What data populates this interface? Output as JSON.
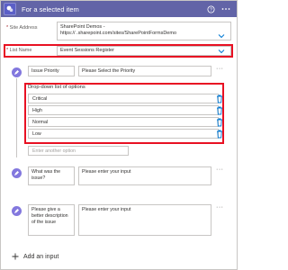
{
  "header": {
    "title": "For a selected item",
    "help_icon": "question-circle-icon",
    "more_icon": "more-dots-icon"
  },
  "site_address": {
    "label": "Site Address",
    "line1": "SharePoint Demos -",
    "line2": "https://                    .sharepoint.com/sites/SharePointFormsDemo"
  },
  "list_name": {
    "label": "List Name",
    "value": "Event Sessions Register"
  },
  "inputs": [
    {
      "title": "Issue Priority",
      "value": "Please Select the Priority",
      "dropdown_label": "Drop-down list of options",
      "options": [
        "Critical",
        "High",
        "Normal",
        "Low"
      ],
      "add_option_placeholder": "Enter another option"
    },
    {
      "title": "What was the issue?",
      "value": "Please enter your input"
    },
    {
      "title": "Please give a better description of the issue",
      "value": "Please enter your input"
    }
  ],
  "add_input_label": "Add an input",
  "colors": {
    "header": "#6264a7",
    "accent": "#8378de",
    "highlight": "#e81123",
    "delete": "#0078d4"
  }
}
